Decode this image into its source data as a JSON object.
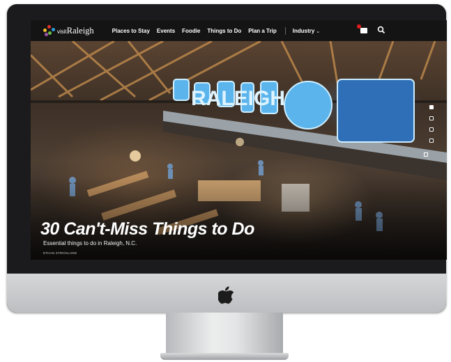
{
  "site": {
    "brand_prefix": "visit",
    "brand_name": "Raleigh",
    "nav_items": [
      {
        "label": "Places to Stay"
      },
      {
        "label": "Events"
      },
      {
        "label": "Foodie"
      },
      {
        "label": "Things to Do"
      },
      {
        "label": "Plan a Trip"
      }
    ],
    "industry_label": "Industry"
  },
  "hero": {
    "title": "30 Can't-Miss Things to Do",
    "subtitle": "Essential things to do in Raleigh, N.C.",
    "credit": "ETHAN STRICKLAND",
    "sign_text": "RALEIGH",
    "slide_count": 5,
    "active_slide": 1
  },
  "colors": {
    "nav_bg": "#151414",
    "badge": "#e21b1b",
    "sign_neon": "#6ec6ff"
  }
}
